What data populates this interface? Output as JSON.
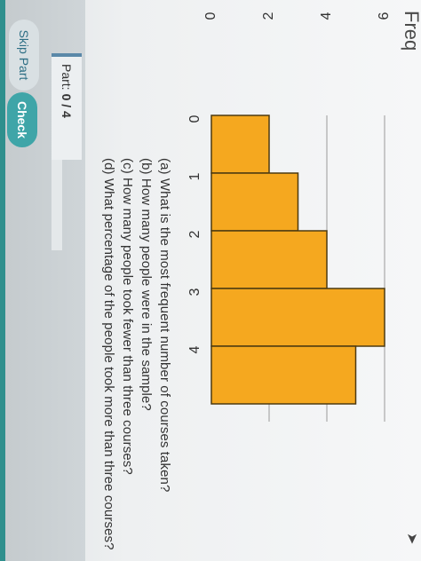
{
  "header": {
    "title_fragment": "Freq"
  },
  "questions": [
    "(a) What is the most frequent number of courses taken?",
    "(b) How many people were in the sample?",
    "(c) How many people took fewer than three courses?",
    "(d) What percentage of the people took more than three courses?"
  ],
  "footer": {
    "part_label": "Part:",
    "part_value": "0 / 4",
    "skip_label": "Skip Part",
    "check_label": "Check"
  },
  "colors": {
    "bar_fill": "#f5a81f",
    "bar_stroke": "#4d3a10",
    "grid": "#9a9a9a",
    "check_button": "#3fa5a8"
  },
  "chart_data": {
    "type": "bar",
    "categories": [
      "0",
      "1",
      "2",
      "3",
      "4"
    ],
    "values": [
      2,
      3,
      4,
      6,
      5
    ],
    "x_ticks": [
      "0",
      "1",
      "2",
      "3",
      "4"
    ],
    "y_ticks": [
      "0",
      "2",
      "4",
      "6"
    ],
    "ylim": [
      0,
      7
    ],
    "grid": true
  },
  "cursor_icon": "cursor-arrow-icon"
}
